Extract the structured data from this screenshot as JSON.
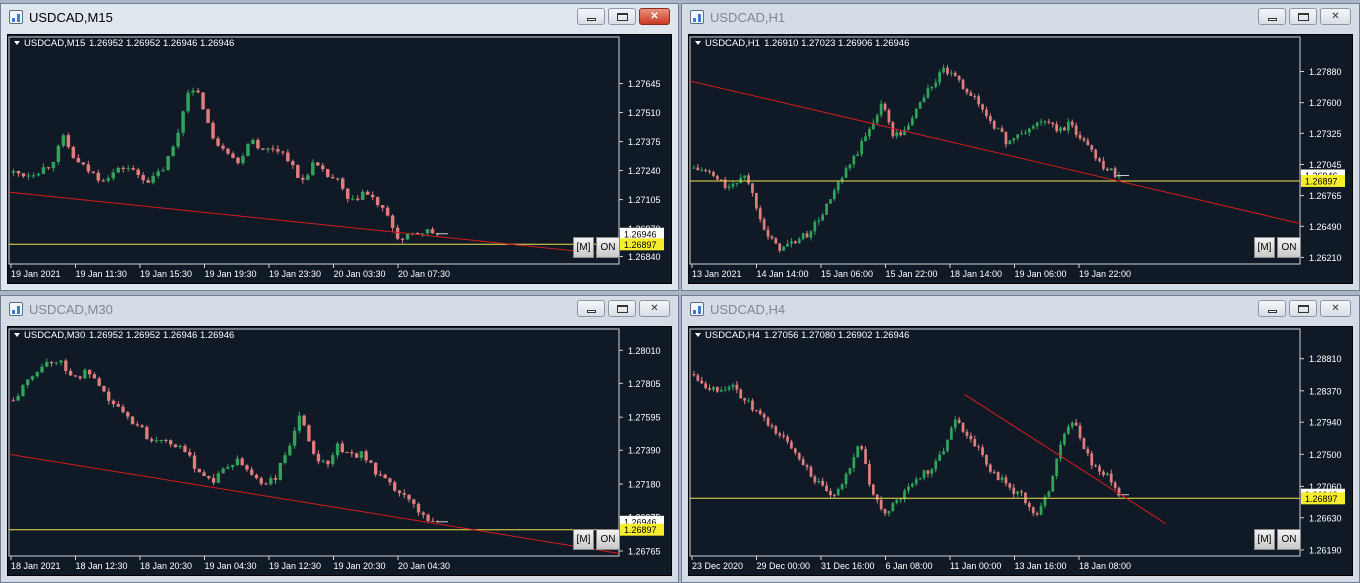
{
  "windows": [
    {
      "id": "m15",
      "title": "USDCAD,M15",
      "active": true,
      "chart": {
        "symbol_label": "USDCAD,M15",
        "ohlc_label": "1.26952 1.26952 1.26946 1.26946",
        "price_labels": [
          "1.27645",
          "1.27510",
          "1.27375",
          "1.27240",
          "1.27105",
          "1.26970",
          "1.26840"
        ],
        "price_values": [
          1.27645,
          1.2751,
          1.27375,
          1.2724,
          1.27105,
          1.2697,
          1.2684
        ],
        "ylim": [
          1.2681,
          1.27815
        ],
        "time_labels": [
          "19 Jan 2021",
          "19 Jan 11:30",
          "19 Jan 15:30",
          "19 Jan 19:30",
          "19 Jan 23:30",
          "20 Jan 03:30",
          "20 Jan 07:30"
        ],
        "current_price": "1.26946",
        "current_value": 1.26946,
        "hline_label": "1.26897",
        "hline_value": 1.26897,
        "trend_from": [
          0,
          1.2714
        ],
        "trend_to": [
          1.0,
          1.26845
        ],
        "path": [
          1.2723,
          1.2722,
          1.2724,
          1.2727,
          1.2739,
          1.2728,
          1.2724,
          1.272,
          1.2723,
          1.2726,
          1.2722,
          1.2719,
          1.2725,
          1.2737,
          1.2762,
          1.2758,
          1.2738,
          1.2735,
          1.2727,
          1.274,
          1.2733,
          1.2735,
          1.273,
          1.2718,
          1.2727,
          1.2722,
          1.2719,
          1.2708,
          1.2714,
          1.271,
          1.2702,
          1.2691,
          1.2694,
          1.2696,
          1.26946
        ],
        "candles": 86
      },
      "btn_m": "[M]",
      "btn_on": "ON"
    },
    {
      "id": "h1",
      "title": "USDCAD,H1",
      "active": false,
      "chart": {
        "symbol_label": "USDCAD,H1",
        "ohlc_label": "1.26910 1.27023 1.26906 1.26946",
        "price_labels": [
          "1.27880",
          "1.27600",
          "1.27325",
          "1.27045",
          "1.26975",
          "1.26765",
          "1.26490",
          "1.26210"
        ],
        "price_values": [
          1.2788,
          1.276,
          1.27325,
          1.27045,
          1.26975,
          1.26765,
          1.2649,
          1.2621
        ],
        "ylim": [
          1.2616,
          1.281
        ],
        "time_labels": [
          "13 Jan 2021",
          "14 Jan 14:00",
          "15 Jan 06:00",
          "15 Jan 22:00",
          "18 Jan 14:00",
          "19 Jan 06:00",
          "19 Jan 22:00"
        ],
        "current_price": "1.26946",
        "current_value": 1.26946,
        "hline_label": "1.26897",
        "hline_value": 1.26897,
        "trend_from": [
          0,
          1.27795
        ],
        "trend_to": [
          1.0,
          1.26515
        ],
        "path": [
          1.2701,
          1.2698,
          1.269,
          1.2682,
          1.2698,
          1.2668,
          1.2637,
          1.2629,
          1.2635,
          1.2641,
          1.2655,
          1.2675,
          1.2695,
          1.2714,
          1.2735,
          1.276,
          1.273,
          1.2735,
          1.276,
          1.2775,
          1.279,
          1.278,
          1.277,
          1.2755,
          1.274,
          1.2725,
          1.273,
          1.2738,
          1.2745,
          1.2735,
          1.274,
          1.2728,
          1.2715,
          1.27,
          1.26946
        ],
        "candles": 110
      },
      "btn_m": "[M]",
      "btn_on": "ON"
    },
    {
      "id": "m30",
      "title": "USDCAD,M30",
      "active": false,
      "chart": {
        "symbol_label": "USDCAD,M30",
        "ohlc_label": "1.26952 1.26952 1.26946 1.26946",
        "price_labels": [
          "1.28010",
          "1.27805",
          "1.27595",
          "1.27390",
          "1.27180",
          "1.26975",
          "1.26765"
        ],
        "price_values": [
          1.2801,
          1.27805,
          1.27595,
          1.2739,
          1.2718,
          1.26975,
          1.26765
        ],
        "ylim": [
          1.2674,
          1.2808
        ],
        "time_labels": [
          "18 Jan 2021",
          "18 Jan 12:30",
          "18 Jan 20:30",
          "19 Jan 04:30",
          "19 Jan 12:30",
          "19 Jan 20:30",
          "20 Jan 04:30"
        ],
        "current_price": "1.26946",
        "current_value": 1.26946,
        "hline_label": "1.26897",
        "hline_value": 1.26897,
        "trend_from": [
          0,
          1.27365
        ],
        "trend_to": [
          1.0,
          1.2675
        ],
        "path": [
          1.277,
          1.278,
          1.279,
          1.2795,
          1.2792,
          1.2783,
          1.2788,
          1.2775,
          1.2768,
          1.276,
          1.2755,
          1.2745,
          1.2748,
          1.2742,
          1.2735,
          1.2725,
          1.272,
          1.2728,
          1.2732,
          1.2725,
          1.2718,
          1.2722,
          1.274,
          1.276,
          1.2738,
          1.273,
          1.2742,
          1.2735,
          1.2738,
          1.2725,
          1.2718,
          1.2712,
          1.2705,
          1.2698,
          1.26946
        ],
        "candles": 90
      },
      "btn_m": "[M]",
      "btn_on": "ON"
    },
    {
      "id": "h4",
      "title": "USDCAD,H4",
      "active": false,
      "chart": {
        "symbol_label": "USDCAD,H4",
        "ohlc_label": "1.27056 1.27080 1.26902 1.26946",
        "price_labels": [
          "1.28810",
          "1.28370",
          "1.27940",
          "1.27500",
          "1.27060",
          "1.26630",
          "1.26190"
        ],
        "price_values": [
          1.2881,
          1.2837,
          1.2794,
          1.275,
          1.2706,
          1.2663,
          1.2619
        ],
        "ylim": [
          1.2612,
          1.2908
        ],
        "time_labels": [
          "23 Dec 2020",
          "29 Dec 00:00",
          "31 Dec 16:00",
          "6 Jan 08:00",
          "11 Jan 00:00",
          "13 Jan 16:00",
          "18 Jan 08:00"
        ],
        "current_price": "1.26946",
        "current_value": 1.26946,
        "hline_label": "1.26897",
        "hline_value": 1.26897,
        "trend_from": [
          0.45,
          1.2832
        ],
        "trend_to": [
          0.78,
          1.2655
        ],
        "path": [
          1.286,
          1.2845,
          1.2838,
          1.2845,
          1.283,
          1.2812,
          1.2795,
          1.278,
          1.2765,
          1.2745,
          1.272,
          1.27,
          1.269,
          1.2725,
          1.277,
          1.27,
          1.267,
          1.268,
          1.27,
          1.272,
          1.273,
          1.275,
          1.28,
          1.278,
          1.276,
          1.273,
          1.2715,
          1.27,
          1.269,
          1.266,
          1.27,
          1.276,
          1.28,
          1.276,
          1.273,
          1.272,
          1.26946
        ],
        "candles": 110
      },
      "btn_m": "[M]",
      "btn_on": "ON"
    }
  ],
  "colors": {
    "chart_bg": "#101a27",
    "bull": "#2fa35a",
    "bear": "#e07c7c",
    "trend": "#d21c1c",
    "hline": "#f0e24a",
    "text": "#ffffff",
    "price_tag_bg": "#ffffff",
    "hline_tag_bg": "#f6ee2c"
  },
  "icons": {
    "app": "chart-window-icon",
    "min": "minimize-icon",
    "max": "maximize-icon",
    "close": "close-icon"
  }
}
